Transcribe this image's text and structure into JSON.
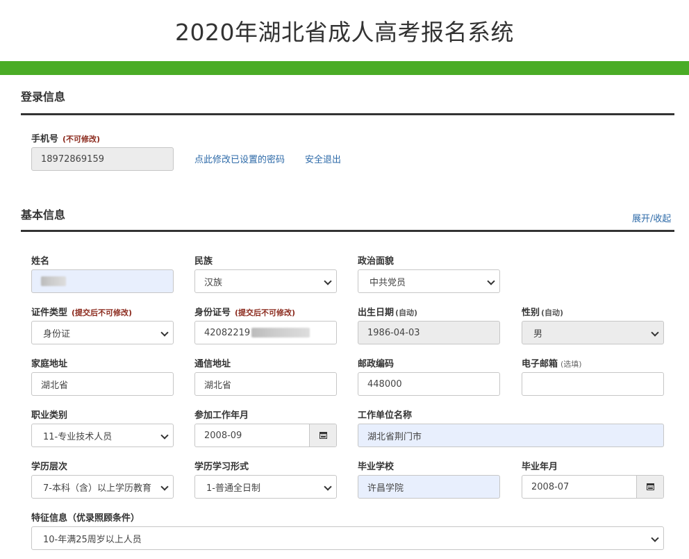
{
  "page": {
    "title": "2020年湖北省成人高考报名系统"
  },
  "colors": {
    "accent_bar": "#4aac26",
    "link": "#2d6aa8",
    "note": "#8b2a1d"
  },
  "login": {
    "title": "登录信息",
    "phone_label": "手机号",
    "phone_note": "(不可修改)",
    "phone_value": "18972869159",
    "change_password_link": "点此修改已设置的密码",
    "logout_link": "安全退出"
  },
  "basic": {
    "title": "基本信息",
    "toggle_link": "展开/收起",
    "name_label": "姓名",
    "ethnicity_label": "民族",
    "ethnicity_value": "汉族",
    "political_label": "政治面貌",
    "political_value": "中共党员",
    "id_type_label": "证件类型",
    "id_type_note": "(提交后不可修改)",
    "id_type_value": "身份证",
    "id_number_label": "身份证号",
    "id_number_note": "(提交后不可修改)",
    "id_number_value": "42082219",
    "birth_label": "出生日期",
    "birth_note": "(自动)",
    "birth_value": "1986-04-03",
    "gender_label": "性别",
    "gender_note": "(自动)",
    "gender_value": "男",
    "home_address_label": "家庭地址",
    "home_address_value": "湖北省",
    "mail_address_label": "通信地址",
    "mail_address_value": "湖北省",
    "postal_label": "邮政编码",
    "postal_value": "448000",
    "email_label": "电子邮箱",
    "email_note": "(选填)",
    "email_value": "",
    "occupation_label": "职业类别",
    "occupation_value": "11-专业技术人员",
    "work_start_label": "参加工作年月",
    "work_start_value": "2008-09",
    "employer_label": "工作单位名称",
    "employer_value": "湖北省荆门市",
    "edu_level_label": "学历层次",
    "edu_level_value": "7-本科（含）以上学历教育",
    "study_form_label": "学历学习形式",
    "study_form_value": "1-普通全日制",
    "school_label": "毕业学校",
    "school_value": "许昌学院",
    "grad_date_label": "毕业年月",
    "grad_date_value": "2008-07",
    "feature_label": "特征信息（优录照顾条件）",
    "feature_value": "10-年满25周岁以上人员"
  }
}
